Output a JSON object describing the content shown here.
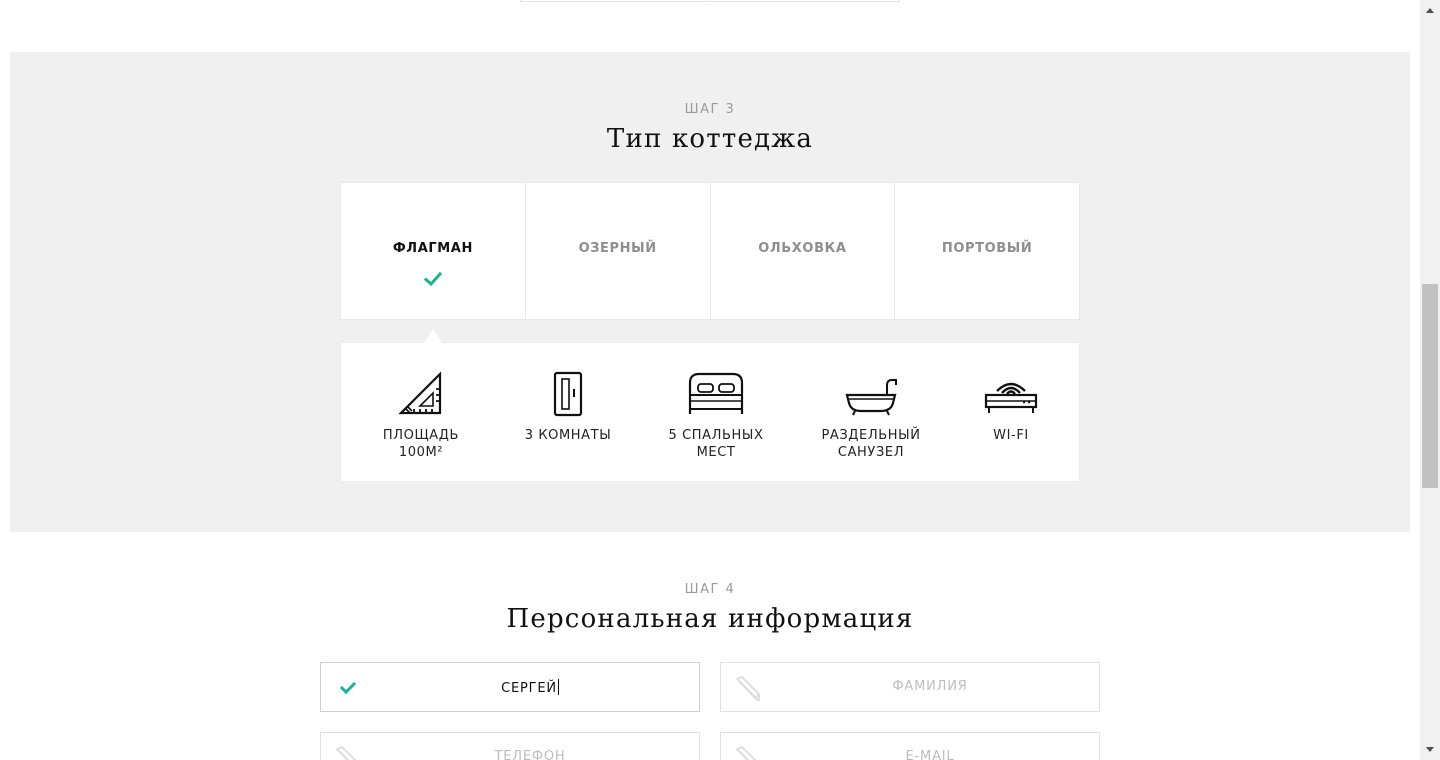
{
  "step3": {
    "label": "ШАГ 3",
    "title": "Тип коттеджа",
    "tabs": [
      {
        "label": "ФЛАГМАН",
        "selected": true
      },
      {
        "label": "ОЗЕРНЫЙ",
        "selected": false
      },
      {
        "label": "ОЛЬХОВКА",
        "selected": false
      },
      {
        "label": "ПОРТОВЫЙ",
        "selected": false
      }
    ],
    "features": [
      {
        "icon": "ruler-triangle-icon",
        "label": "ПЛОЩАДЬ\n100М²"
      },
      {
        "icon": "door-icon",
        "label": "3 КОМНАТЫ"
      },
      {
        "icon": "bed-icon",
        "label": "5 СПАЛЬНЫХ\nМЕСТ"
      },
      {
        "icon": "bathtub-icon",
        "label": "РАЗДЕЛЬНЫЙ\nСАНУЗЕЛ"
      },
      {
        "icon": "wifi-router-icon",
        "label": "WI-FI"
      }
    ]
  },
  "step4": {
    "label": "ШАГ 4",
    "title": "Персональная информация",
    "fields": {
      "first_name": {
        "value": "СЕРГЕЙ",
        "placeholder": "",
        "state": "valid"
      },
      "last_name": {
        "value": "",
        "placeholder": "ФАМИЛИЯ"
      },
      "phone": {
        "value": "",
        "placeholder": "ТЕЛЕФОН"
      },
      "email": {
        "value": "",
        "placeholder": "E-MAIL"
      }
    }
  },
  "colors": {
    "accent": "#1ab394",
    "section_bg": "#f0f0f0",
    "muted_text": "#8e8e8e",
    "placeholder": "#bdbdbd"
  }
}
